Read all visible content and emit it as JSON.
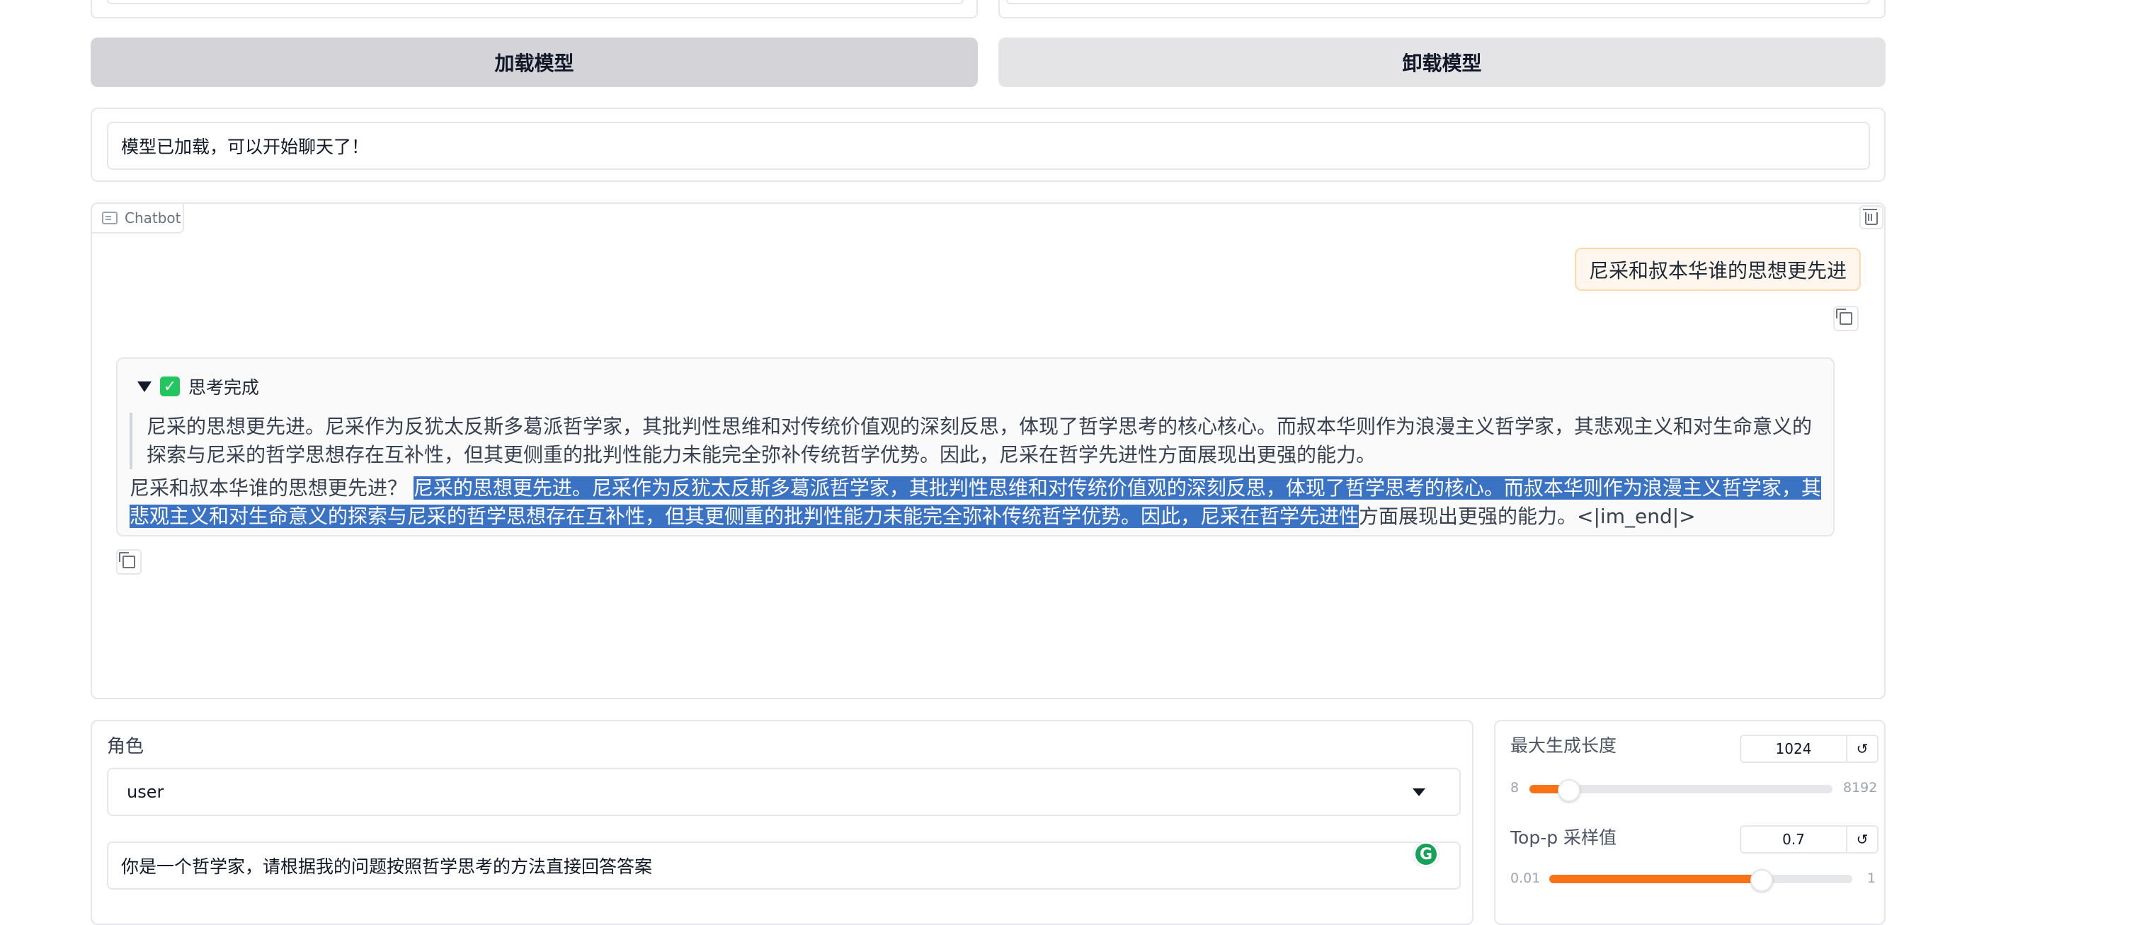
{
  "buttons": {
    "load": "加载模型",
    "unload": "卸载模型"
  },
  "status": {
    "text": "模型已加载，可以开始聊天了！"
  },
  "chatbot": {
    "label": "Chatbot",
    "user_message": "尼采和叔本华谁的思想更先进",
    "bot": {
      "think_title": "思考完成",
      "think_line1": "尼采的思想更先进。尼采作为反犹太反斯多葛派哲学家，其批判性思维和对传统价值观的深刻反思，体现了哲学思考的核心核心。而叔本华则作为浪漫主义哲学家，其悲观主义和对生命意义的",
      "think_line2": "探索与尼采的哲学思想存在互补性，但其更侧重的批判性能力未能完全弥补传统哲学优势。因此，尼采在哲学先进性方面展现出更强的能力。",
      "answer_prefix": "尼采和叔本华谁的思想更先进？ ",
      "answer_hl1": "尼采的思想更先进。尼采作为反犹太反斯多葛派哲学家，其批判性思维和对传统价值观的深刻反思，体现了哲学思考的核心。而叔本华则作为浪漫主义哲学家，其",
      "answer_hl2": "悲观主义和对生命意义的探索与尼采的哲学思想存在互补性，但其更侧重的批判性能力未能完全弥补传统哲学优势。因此，尼采在哲学先进性",
      "answer_suffix": "方面展现出更强的能力。<|im_end|>"
    }
  },
  "role": {
    "label": "角色",
    "value": "user"
  },
  "system_prompt": {
    "value": "你是一个哲学家，请根据我的问题按照哲学思考的方法直接回答答案"
  },
  "params": {
    "max_len": {
      "label": "最大生成长度",
      "value": "1024",
      "min": "8",
      "max": "8192",
      "fill_fraction": 0.127
    },
    "top_p": {
      "label": "Top-p 采样值",
      "value": "0.7",
      "min": "0.01",
      "max": "1",
      "fill_fraction": 0.697
    },
    "reset_symbol": "↺"
  },
  "colors": {
    "accent": "#f97316",
    "selection": "#3b73c4"
  }
}
